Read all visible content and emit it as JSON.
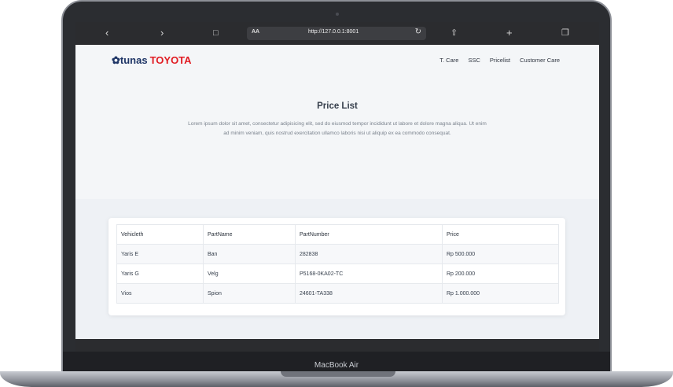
{
  "device": {
    "model": "MacBook Air"
  },
  "browser": {
    "back_icon": "chevron-left-icon",
    "forward_icon": "chevron-right-icon",
    "reader_icon": "book-icon",
    "text_size": "AA",
    "url": "http://127.0.0.1:8001",
    "reload_icon": "reload-icon",
    "share_icon": "share-icon",
    "new_tab_icon": "plus-icon",
    "tabs_icon": "tabs-icon"
  },
  "site": {
    "logo_tunas": "tunas",
    "logo_toyota": "TOYOTA",
    "nav": [
      "T. Care",
      "SSC",
      "Pricelist",
      "Customer Care"
    ]
  },
  "hero": {
    "title": "Price List",
    "text": "Lorem ipsum dolor sit amet, consectetur adipisicing elit, sed do eiusmod tempor incididunt ut labore et dolore magna aliqua. Ut enim ad minim veniam, quis nostrud exercitation ullamco laboris nisi ut aliquip ex ea commodo consequat."
  },
  "table": {
    "headers": [
      "Vehicleth",
      "PartName",
      "PartNumber",
      "Price"
    ],
    "rows": [
      [
        "Yaris E",
        "Ban",
        "282838",
        "Rp 500.000"
      ],
      [
        "Yaris G",
        "Velg",
        "P5168-0KA02-TC",
        "Rp 200.000"
      ],
      [
        "Vios",
        "Spion",
        "24601-TA338",
        "Rp 1.000.000"
      ]
    ]
  },
  "colors": {
    "brand_navy": "#1e3566",
    "brand_red": "#e11b22",
    "toolbar": "#2b2c2f"
  }
}
